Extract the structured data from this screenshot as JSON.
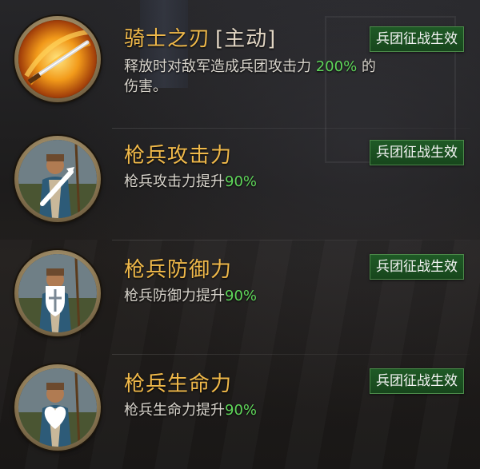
{
  "skills": [
    {
      "title": "骑士之刃",
      "tag": "[主动]",
      "badge": "兵团征战生效",
      "desc_prefix": "释放时对敌军造成兵团攻击力 ",
      "desc_value": "200%",
      "desc_suffix": " 的",
      "desc_line2": "伤害。",
      "icon": "golden-blade-icon"
    },
    {
      "title": "枪兵攻击力",
      "badge": "兵团征战生效",
      "desc_prefix": "枪兵攻击力提升",
      "desc_value": "90%",
      "icon": "spearman-attack-icon"
    },
    {
      "title": "枪兵防御力",
      "badge": "兵团征战生效",
      "desc_prefix": "枪兵防御力提升",
      "desc_value": "90%",
      "icon": "spearman-defense-icon"
    },
    {
      "title": "枪兵生命力",
      "badge": "兵团征战生效",
      "desc_prefix": "枪兵生命力提升",
      "desc_value": "90%",
      "icon": "spearman-health-icon"
    }
  ],
  "colors": {
    "title": "#f0b94a",
    "highlight": "#5fd65a",
    "badge_bg": "#1f5a26"
  }
}
